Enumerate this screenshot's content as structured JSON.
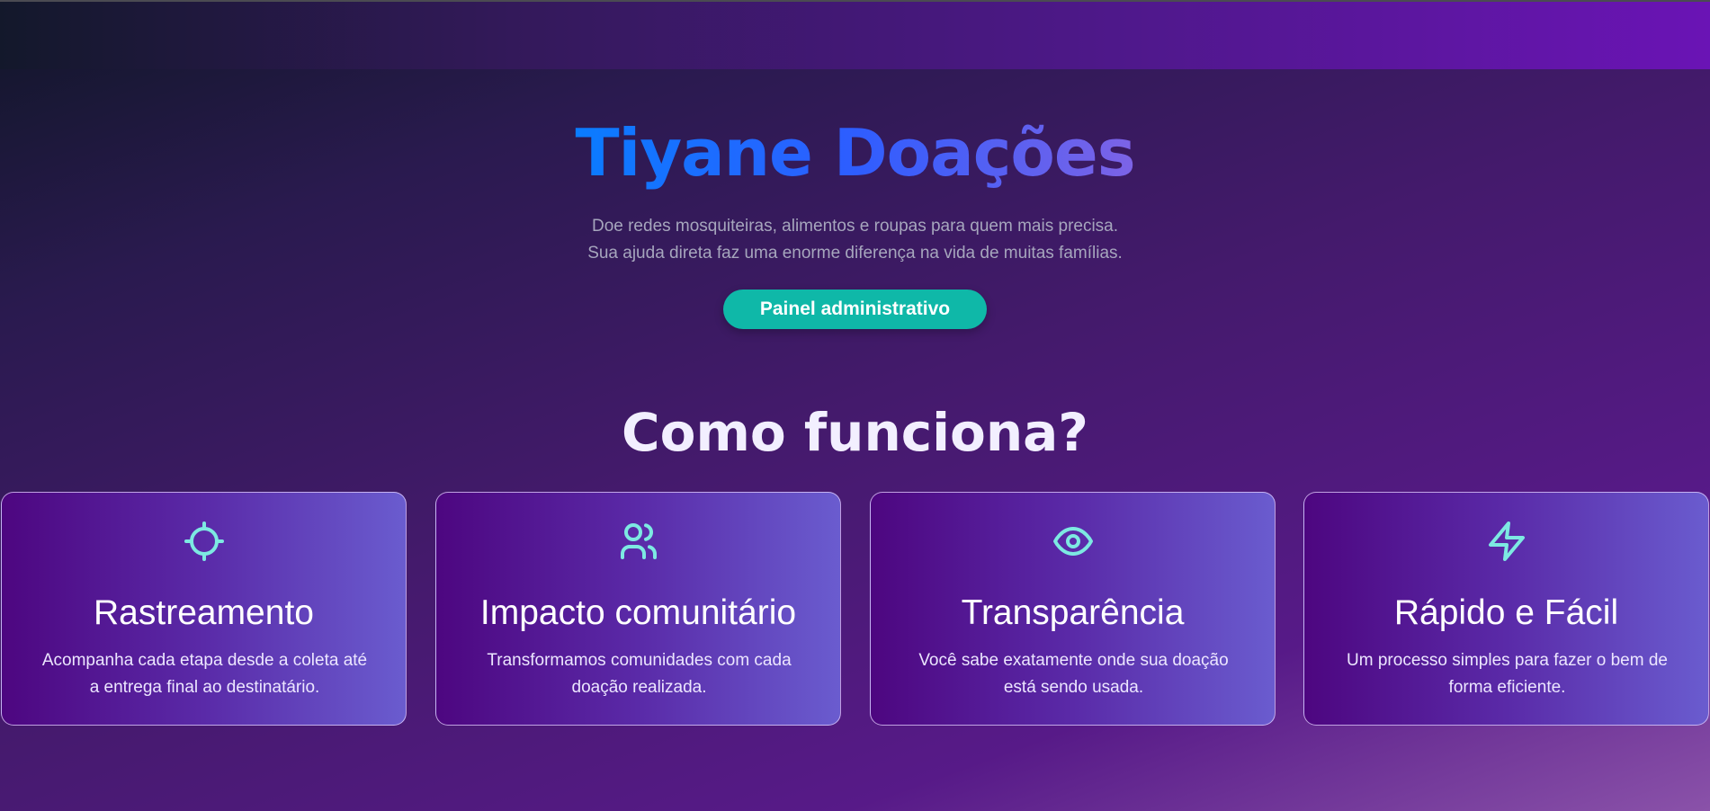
{
  "hero": {
    "title": "Tiyane Doações",
    "description_line1": "Doe redes mosquiteiras, alimentos e roupas para quem mais precisa.",
    "description_line2": "Sua ajuda direta faz uma enorme diferença na vida de muitas famílias.",
    "admin_button_label": "Painel administrativo"
  },
  "section": {
    "title": "Como funciona?"
  },
  "features": [
    {
      "icon": "crosshair-icon",
      "title": "Rastreamento",
      "description": "Acompanha cada etapa desde a coleta até a entrega final ao destinatário."
    },
    {
      "icon": "users-icon",
      "title": "Impacto comunitário",
      "description": "Transformamos comunidades com cada doação realizada."
    },
    {
      "icon": "eye-icon",
      "title": "Transparência",
      "description": "Você sabe exatamente onde sua doação está sendo usada."
    },
    {
      "icon": "lightning-icon",
      "title": "Rápido e Fácil",
      "description": "Um processo simples para fazer o bem de forma eficiente."
    }
  ],
  "colors": {
    "accent_teal": "#0fb8a8",
    "icon_color": "#7de9e2",
    "title_gradient_start": "#0a7cff",
    "title_gradient_end": "#7d63e6"
  }
}
